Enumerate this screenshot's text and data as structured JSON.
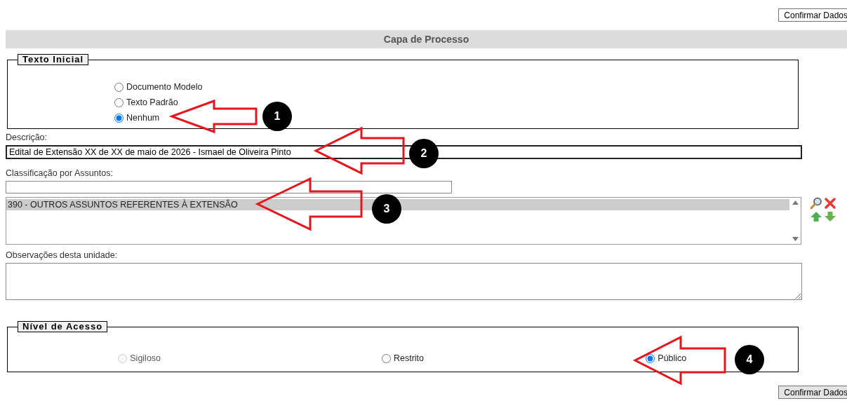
{
  "top_button": {
    "label": "Confirmar Dados"
  },
  "header": {
    "title": "Capa de Processo"
  },
  "texto_inicial": {
    "legend": "Texto Inicial",
    "options": [
      {
        "label": "Documento Modelo",
        "selected": false
      },
      {
        "label": "Texto Padrão",
        "selected": false
      },
      {
        "label": "Nenhum",
        "selected": true
      }
    ]
  },
  "descricao": {
    "label": "Descrição:",
    "value": "Edital de Extensão XX de XX de maio de 2026 - Ismael de Oliveira Pinto"
  },
  "classificacao": {
    "label": "Classificação por Assuntos:",
    "items": [
      {
        "text": "390 - OUTROS ASSUNTOS REFERENTES À EXTENSÃO",
        "selected": true
      }
    ]
  },
  "observacoes": {
    "label": "Observações desta unidade:"
  },
  "nivel_acesso": {
    "legend": "Nível de Acesso",
    "options": [
      {
        "label": "Sigiloso",
        "selected": false,
        "disabled": true
      },
      {
        "label": "Restrito",
        "selected": false,
        "disabled": false
      },
      {
        "label": "Público",
        "selected": true,
        "disabled": false
      }
    ]
  },
  "bottom_button": {
    "label": "Confirmar Dados"
  },
  "annotations": [
    {
      "number": "1"
    },
    {
      "number": "2"
    },
    {
      "number": "3"
    },
    {
      "number": "4"
    }
  ]
}
